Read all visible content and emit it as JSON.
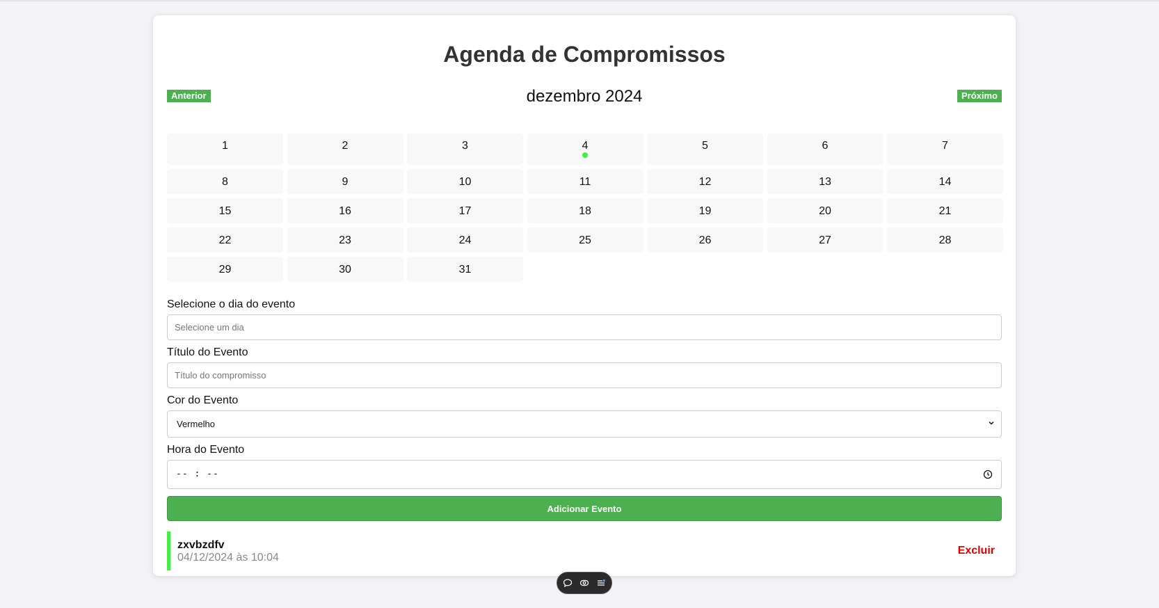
{
  "header": {
    "title": "Agenda de Compromissos"
  },
  "calendar": {
    "month_label": "dezembro 2024",
    "prev_label": "Anterior",
    "next_label": "Próximo",
    "days": [
      "1",
      "2",
      "3",
      "4",
      "5",
      "6",
      "7",
      "8",
      "9",
      "10",
      "11",
      "12",
      "13",
      "14",
      "15",
      "16",
      "17",
      "18",
      "19",
      "20",
      "21",
      "22",
      "23",
      "24",
      "25",
      "26",
      "27",
      "28",
      "29",
      "30",
      "31"
    ],
    "event_day": "4",
    "event_dot_color": "#44ee44"
  },
  "form": {
    "day_label": "Selecione o dia do evento",
    "day_placeholder": "Selecione um dia",
    "title_label": "Título do Evento",
    "title_placeholder": "Título do compromisso",
    "color_label": "Cor do Evento",
    "color_value": "Vermelho",
    "time_label": "Hora do Evento",
    "time_value": "-- : --",
    "submit_label": "Adicionar Evento"
  },
  "events": [
    {
      "title": "zxvbzdfv",
      "when": "04/12/2024 às 10:04",
      "color": "#44ee44",
      "delete_label": "Excluir"
    }
  ],
  "theme": {
    "accent": "#4caf50",
    "danger": "#e00000"
  },
  "toolbar": {
    "icons": [
      "chat-icon",
      "eye-icon",
      "list-settings-icon"
    ]
  }
}
